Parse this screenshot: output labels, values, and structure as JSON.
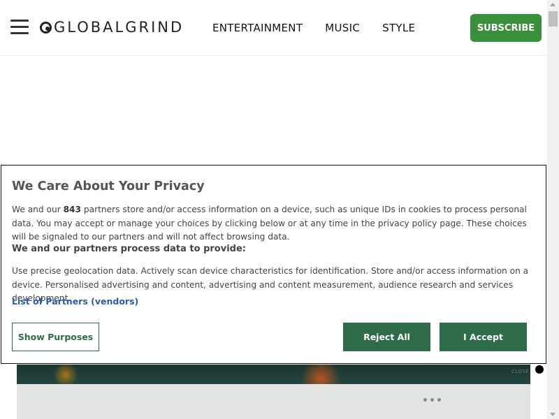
{
  "header": {
    "logo": "GLOBALGRIND",
    "nav": [
      "ENTERTAINMENT",
      "MUSIC",
      "STYLE"
    ],
    "subscribe_label": "SUBSCRIBE"
  },
  "privacy": {
    "title": "We Care About Your Privacy",
    "intro_pre": "We and our ",
    "partner_count": "843",
    "intro_post": " partners store and/or access information on a device, such as unique IDs in cookies to process personal data. You may accept or manage your choices by clicking below or at any time in the privacy policy page. These choices will be signaled to our partners and will not affect browsing data.",
    "process_heading": "We and our partners process data to provide:",
    "process_text": "Use precise geolocation data. Actively scan device characteristics for identification. Store and/or access information on a device. Personalised advertising and content, advertising and content measurement, audience research and services development.",
    "vendors_link": "List of Partners (vendors)",
    "buttons": {
      "show_purposes": "Show Purposes",
      "reject_all": "Reject All",
      "accept": "I Accept"
    }
  },
  "video": {
    "close_label": "CLOSE"
  },
  "colors": {
    "accent_green": "#3b8f3c",
    "button_green": "#2e6b48",
    "link_blue": "#2f5aa8"
  }
}
